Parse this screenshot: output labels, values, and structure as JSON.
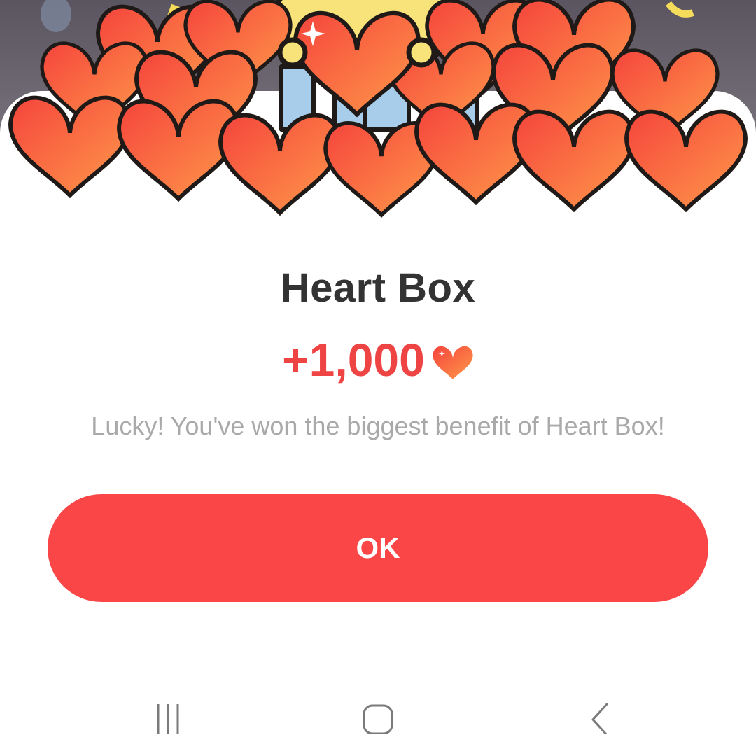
{
  "dialog": {
    "title": "Heart Box",
    "reward_amount": "+1,000",
    "message": "Lucky! You've won the biggest benefit of Heart Box!",
    "ok_label": "OK"
  },
  "colors": {
    "accent": "#fa4646",
    "reward_text": "#ef4444",
    "title_text": "#333333",
    "message_text": "#a9a9a9",
    "heart_light": "#ff9a4a",
    "heart_dark": "#f5443c"
  },
  "icons": {
    "reward": "heart-icon",
    "nav_recents": "recents-icon",
    "nav_home": "home-icon",
    "nav_back": "back-icon"
  }
}
